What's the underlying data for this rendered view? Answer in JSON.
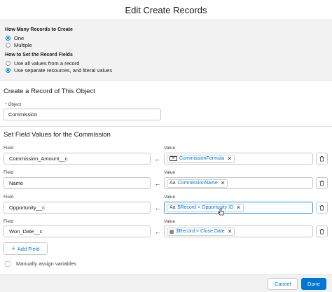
{
  "header": {
    "title": "Edit Create Records"
  },
  "how_many": {
    "label": "How Many Records to Create",
    "options": [
      {
        "label": "One",
        "selected": true
      },
      {
        "label": "Multiple",
        "selected": false
      }
    ]
  },
  "how_to_set": {
    "label": "How to Set the Record Fields",
    "options": [
      {
        "label": "Use all values from a record",
        "selected": false
      },
      {
        "label": "Use separate resources, and literal values",
        "selected": true
      }
    ]
  },
  "create_section": {
    "title": "Create a Record of This Object",
    "object_required_mark": "*",
    "object_label": "Object",
    "object_value": "Commission"
  },
  "field_values": {
    "title": "Set Field Values for the Commission",
    "field_label": "Field",
    "value_label": "Value",
    "arrow_glyph": "←",
    "rows": [
      {
        "field": "Commission_Amount__c",
        "value": "CommissionFormula",
        "icon": "formula-icon",
        "icon_glyph": "fx"
      },
      {
        "field": "Name",
        "value": "CommissionName",
        "icon": "text-resource-icon",
        "icon_glyph": "Aa"
      },
      {
        "field": "Opportunity__c",
        "value": "$Record > Opportunity ID",
        "icon": "text-resource-icon",
        "icon_glyph": "Aa"
      },
      {
        "field": "Won_Date__c",
        "value": "$Record > Close Date",
        "icon": "calendar-icon",
        "icon_glyph": "▦"
      }
    ],
    "remove_glyph": "✕"
  },
  "add_field_button": {
    "label": "Add Field",
    "icon": "plus-icon",
    "glyph": "+"
  },
  "manual_assign": {
    "label": "Manually assign variables",
    "checked": false
  },
  "footer": {
    "cancel_label": "Cancel",
    "done_label": "Done"
  },
  "colors": {
    "accent": "#0176d3",
    "panel_bg": "#f3f2f2",
    "border": "#c9c9c9",
    "required": "#c23934"
  }
}
